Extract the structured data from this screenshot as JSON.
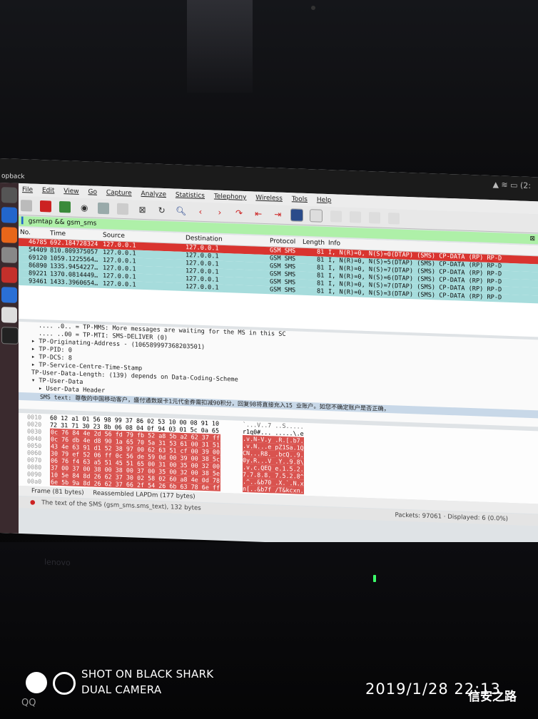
{
  "topbar": {
    "window_title": "opback",
    "sys_tray": "(2:"
  },
  "menu": [
    "File",
    "Edit",
    "View",
    "Go",
    "Capture",
    "Analyze",
    "Statistics",
    "Telephony",
    "Wireless",
    "Tools",
    "Help"
  ],
  "filter": {
    "value": "gsmtap && gsm_sms"
  },
  "packet_list": {
    "columns": [
      "No.",
      "Time",
      "Source",
      "Destination",
      "Protocol",
      "Length",
      "Info"
    ],
    "rows": [
      {
        "no": "46785",
        "time": "692.184728324",
        "source": "127.0.0.1",
        "destination": "127.0.0.1",
        "protocol": "GSM SMS",
        "length": "81",
        "info": "I, N(R)=0, N(S)=0(DTAP) (SMS) CP-DATA (RP) RP-D"
      },
      {
        "no": "54409",
        "time": "810.809375057",
        "source": "127.0.0.1",
        "destination": "127.0.0.1",
        "protocol": "GSM SMS",
        "length": "81",
        "info": "I, N(R)=0, N(S)=5(DTAP) (SMS) CP-DATA (RP) RP-D"
      },
      {
        "no": "69120",
        "time": "1059.1225564…",
        "source": "127.0.0.1",
        "destination": "127.0.0.1",
        "protocol": "GSM SMS",
        "length": "81",
        "info": "I, N(R)=0, N(S)=7(DTAP) (SMS) CP-DATA (RP) RP-D"
      },
      {
        "no": "86890",
        "time": "1335.9454227…",
        "source": "127.0.0.1",
        "destination": "127.0.0.1",
        "protocol": "GSM SMS",
        "length": "81",
        "info": "I, N(R)=0, N(S)=6(DTAP) (SMS) CP-DATA (RP) RP-D"
      },
      {
        "no": "89221",
        "time": "1370.0814449…",
        "source": "127.0.0.1",
        "destination": "127.0.0.1",
        "protocol": "GSM SMS",
        "length": "81",
        "info": "I, N(R)=0, N(S)=7(DTAP) (SMS) CP-DATA (RP) RP-D"
      },
      {
        "no": "93461",
        "time": "1433.3960654…",
        "source": "127.0.0.1",
        "destination": "127.0.0.1",
        "protocol": "GSM SMS",
        "length": "81",
        "info": "I, N(R)=0, N(S)=3(DTAP) (SMS) CP-DATA (RP) RP-D"
      }
    ]
  },
  "details": [
    ".... .0.. = TP-MMS: More messages are waiting for the MS in this SC",
    ".... ..00 = TP-MTI: SMS-DELIVER (0)",
    "▸ TP-Originating-Address - (106589997368203501)",
    "▸ TP-PID: 0",
    "▸ TP-DCS: 8",
    "▸ TP-Service-Centre-Time-Stamp",
    "  TP-User-Data-Length: (139) depends on Data-Coding-Scheme",
    "▾ TP-User-Data",
    "   ▸ User-Data Header",
    "      SMS text: 尊敬的中国移动客户，盛付通数娱卡1元代金券需扣减90积分，回复98将直接充入15          业账户。如您不确定账户是否正确，"
  ],
  "hex": [
    {
      "off": "0010",
      "bytes": "60 12 a1 01 56 98 99 37  86 02 53 10 00 08 91 10",
      "ascii": "`...V..7 ..S....."
    },
    {
      "off": "0020",
      "bytes": "72 31 71 30 23 8b 06 08  04 0f 94 03 01 5c 0a 65",
      "ascii": "r1q0#... .....\\.e"
    },
    {
      "off": "0030",
      "bytes": "0c 76 84 4e 2d 56 fd 79  fb 52 a8 5b a2 62 37 ff",
      "ascii": ".v.N-V.y .R.[.b7."
    },
    {
      "off": "0040",
      "bytes": "0c 76 db 4e d8 90 1a 65  70 5a 31 53 61 00 31 51",
      "ascii": ".v.N...e pZ1Sa.1Q"
    },
    {
      "off": "0050",
      "bytes": "43 4e 63 91 d1 52 38 97  00 62 63 51 cf 00 39 00",
      "ascii": "CN...R8. .bcQ..9."
    },
    {
      "off": "0060",
      "bytes": "30 79 ef 52 06 ff 0c 56  de 59 0d 00 39 00 38 5c",
      "ascii": "0y.R...V .Y..9.8\\"
    },
    {
      "off": "0070",
      "bytes": "06 76 f4 63 a5 51 45 51  65 00 31 00 35 00 32 00",
      "ascii": ".v.c.QEQ e.1.5.2."
    },
    {
      "off": "0080",
      "bytes": "37 00 37 00 38 00 38 00  37 00 35 00 32 00 38 5e",
      "ascii": "7.7.8.8. 7.5.2.8^"
    },
    {
      "off": "0090",
      "bytes": "10 5e 84 8d 26 62 37 30  02 58 02 60 a8 4e 0d 78",
      "ascii": ".^..&b70 .X.`.N.x"
    },
    {
      "off": "00a0",
      "bytes": "6e 5b 9a 8d 26 62 37 66  2f 54 26 6b 63 78 6e ff",
      "ascii": "n[..&b7f /T&kcxn."
    }
  ],
  "bottom_tabs": {
    "frame": "Frame (81 bytes)",
    "reassembled": "Reassembled LAPDm (177 bytes)"
  },
  "status": {
    "field": "The text of the SMS (gsm_sms.sms_text), 132 bytes",
    "packets": "Packets: 97061 · Displayed: 6 (0.0%)"
  },
  "laptop_brand": "lenovo",
  "watermark": {
    "line1": "SHOT ON BLACK SHARK",
    "line2": "DUAL CAMERA",
    "datetime": "2019/1/28  22:13",
    "brand": "信安之路",
    "qq": "QQ"
  }
}
